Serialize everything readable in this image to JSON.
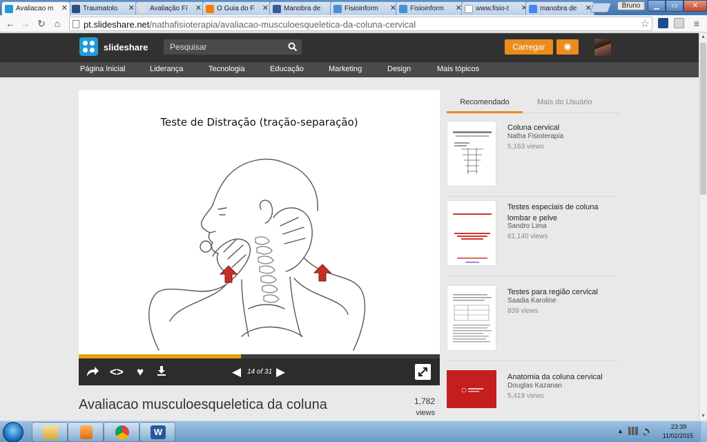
{
  "browser": {
    "tabs": [
      {
        "title": "Avaliacao m",
        "active": true,
        "favicon": "slideshare-icon",
        "color": "#1f9bd7"
      },
      {
        "title": "Traumatolo",
        "active": false,
        "favicon": "page-icon",
        "color": "#2a4f86"
      },
      {
        "title": "Avaliação Fí",
        "active": false,
        "favicon": "lightbulb-icon",
        "color": "#dddddd"
      },
      {
        "title": "O Guia do F",
        "active": false,
        "favicon": "blogger-icon",
        "color": "#f57d00"
      },
      {
        "title": "Manobra de",
        "active": false,
        "favicon": "page-icon",
        "color": "#3b5998"
      },
      {
        "title": "Fisioinform",
        "active": false,
        "favicon": "page-icon",
        "color": "#4a8fd1"
      },
      {
        "title": "Fisioinform",
        "active": false,
        "favicon": "page-icon",
        "color": "#4a8fd1"
      },
      {
        "title": "www.fisio-t",
        "active": false,
        "favicon": "document-icon",
        "color": "#ffffff"
      },
      {
        "title": "manobra de",
        "active": false,
        "favicon": "google-icon",
        "color": "#4285f4"
      }
    ],
    "user_name": "Bruno",
    "window_controls": {
      "minimize": "▁",
      "maximize": "▭",
      "close": "✕"
    },
    "url_host": "pt.slideshare.net",
    "url_path": "/nathafisioterapia/avaliacao-musculoesqueletica-da-coluna-cervical"
  },
  "site": {
    "brand": "slideshare",
    "search_placeholder": "Pesquisar",
    "upload_label": "Carregar",
    "categories": [
      "Página Inicial",
      "Liderança",
      "Tecnologia",
      "Educação",
      "Marketing",
      "Design",
      "Mais tópicos"
    ]
  },
  "player": {
    "slide_title": "Teste de Distração (tração-separação)",
    "current_slide": "14",
    "total_slides": "31",
    "slide_count_label": "14 of 31",
    "progress_fraction": 0.45
  },
  "document": {
    "title": "Avaliacao musculoesqueletica da coluna",
    "views": "1,782",
    "views_label": "views"
  },
  "sidebar": {
    "tabs": [
      "Recomendado",
      "Mais do Usuário"
    ],
    "items": [
      {
        "title": "Coluna cervical",
        "author": "Natha Fisioterapia",
        "views": "5,163 views",
        "thumb": "diagram"
      },
      {
        "title": "Testes especiais de coluna lombar e pelve",
        "author": "Sandro Lima",
        "views": "61,140 views",
        "thumb": "red-text"
      },
      {
        "title": "Testes para região cervical",
        "author": "Saadia Karoline",
        "views": "839 views",
        "thumb": "table"
      },
      {
        "title": "Anatomia da coluna cervical",
        "author": "Douglas Kazanan",
        "views": "5,419 views",
        "thumb": "red-cover"
      }
    ]
  },
  "taskbar": {
    "time": "23:39",
    "date": "11/02/2015",
    "apps": [
      "file-explorer-icon",
      "media-player-icon",
      "chrome-icon",
      "word-icon"
    ]
  },
  "colors": {
    "accent": "#ea8c1e",
    "header_bg": "#313131",
    "nav_bg": "#4a4a4a",
    "progress": "#e8a10f",
    "arrow_red": "#c62f24"
  }
}
